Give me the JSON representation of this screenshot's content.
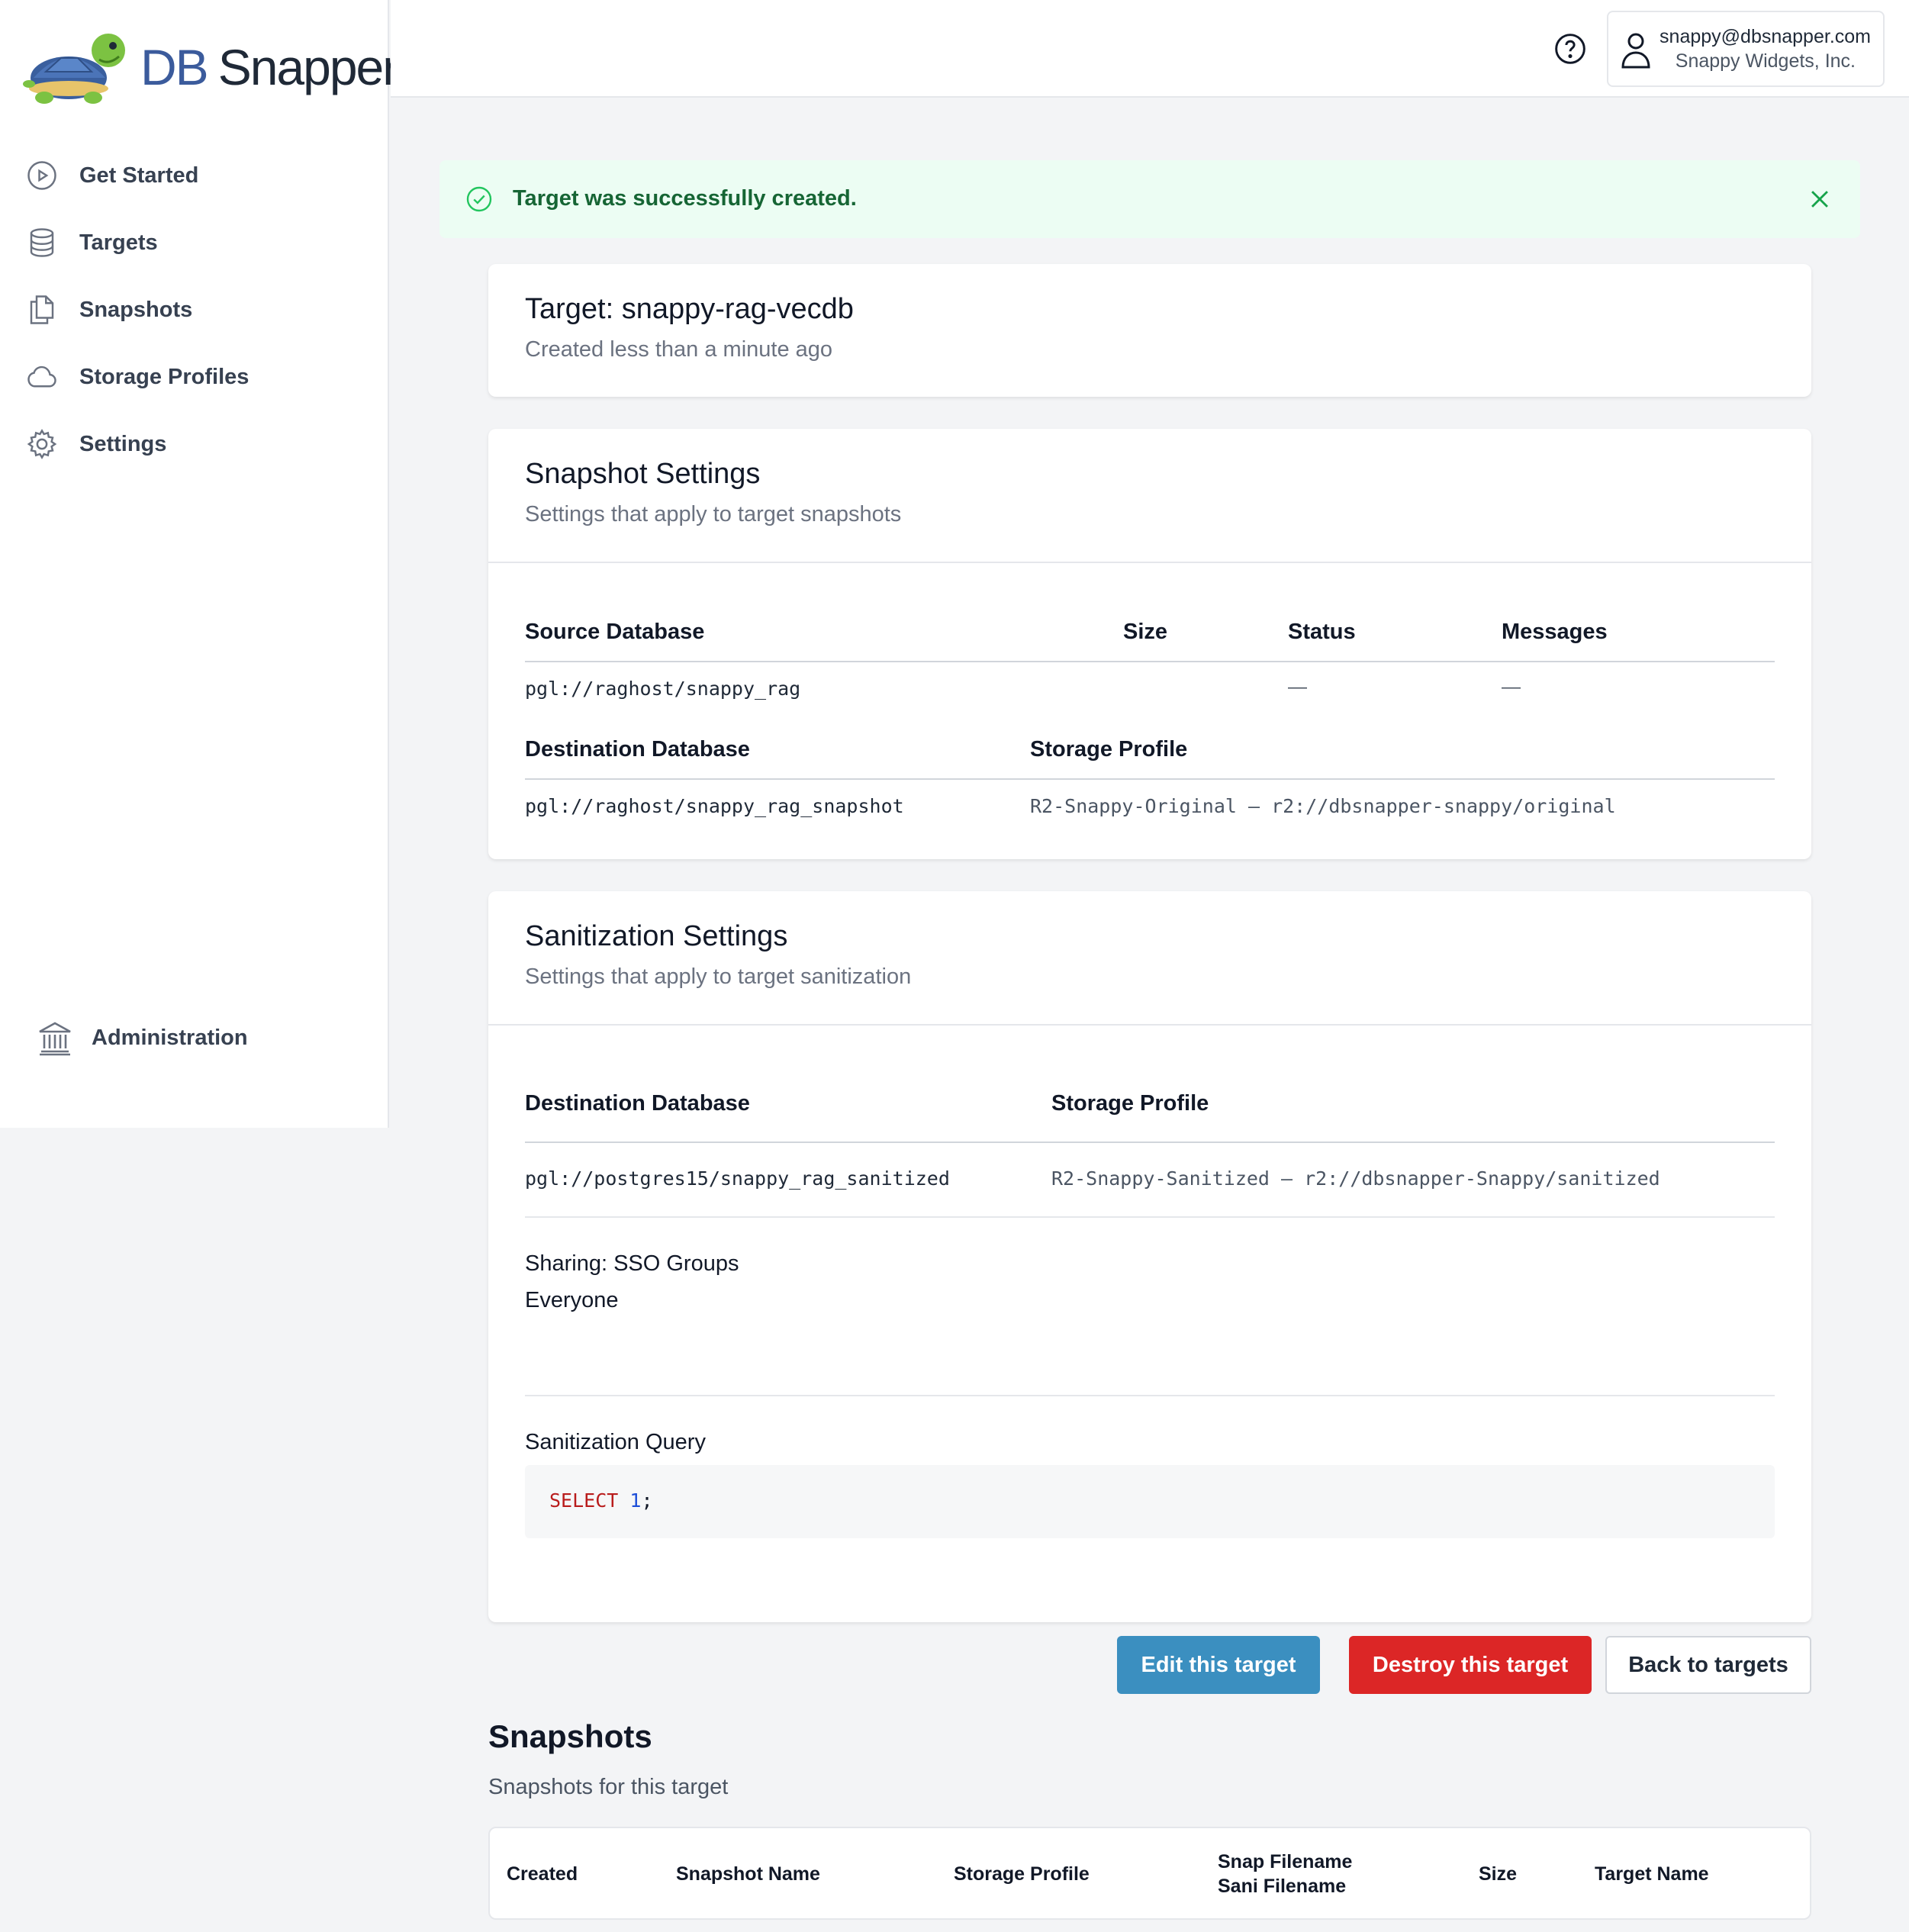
{
  "brand": {
    "name_db": "DB",
    "name_rest": "Snapper"
  },
  "sidebar": {
    "items": [
      {
        "label": "Get Started",
        "icon": "play-circle-icon"
      },
      {
        "label": "Targets",
        "icon": "database-icon"
      },
      {
        "label": "Snapshots",
        "icon": "documents-icon"
      },
      {
        "label": "Storage Profiles",
        "icon": "cloud-icon"
      },
      {
        "label": "Settings",
        "icon": "gear-icon"
      }
    ],
    "admin": {
      "label": "Administration",
      "icon": "bank-icon"
    }
  },
  "header": {
    "user_email": "snappy@dbsnapper.com",
    "user_org": "Snappy Widgets, Inc."
  },
  "alert": {
    "message": "Target was successfully created."
  },
  "target": {
    "title": "Target: snappy-rag-vecdb",
    "created": "Created less than a minute ago"
  },
  "snapshot_settings": {
    "title": "Snapshot Settings",
    "subtitle": "Settings that apply to target snapshots",
    "source_headers": [
      "Source Database",
      "Size",
      "Status",
      "Messages"
    ],
    "source_row": {
      "database": "pgl://raghost/snappy_rag",
      "size": "",
      "status": "—",
      "messages": "—"
    },
    "dest_headers": [
      "Destination Database",
      "Storage Profile"
    ],
    "dest_row": {
      "database": "pgl://raghost/snappy_rag_snapshot",
      "storage_profile": "R2-Snappy-Original – r2://dbsnapper-snappy/original"
    }
  },
  "sanitization_settings": {
    "title": "Sanitization Settings",
    "subtitle": "Settings that apply to target sanitization",
    "dest_headers": [
      "Destination Database",
      "Storage Profile"
    ],
    "dest_row": {
      "database": "pgl://postgres15/snappy_rag_sanitized",
      "storage_profile": "R2-Snappy-Sanitized – r2://dbsnapper-Snappy/sanitized"
    },
    "sharing_label": "Sharing: SSO Groups",
    "sharing_value": "Everyone",
    "query_label": "Sanitization Query",
    "query": {
      "keyword": "SELECT",
      "number": "1",
      "terminator": ";"
    }
  },
  "actions": {
    "edit": "Edit this target",
    "destroy": "Destroy this target",
    "back": "Back to targets"
  },
  "snapshots": {
    "title": "Snapshots",
    "subtitle": "Snapshots for this target",
    "columns": [
      "Created",
      "Snapshot Name",
      "Storage Profile",
      "Snap Filename",
      "Sani Filename",
      "Size",
      "Target Name"
    ]
  },
  "colors": {
    "accent": "#3b8fc0",
    "danger": "#dc2626",
    "success_bg": "#ecfdf3",
    "success_text": "#166534",
    "brand_blue": "#3b5b9c"
  }
}
